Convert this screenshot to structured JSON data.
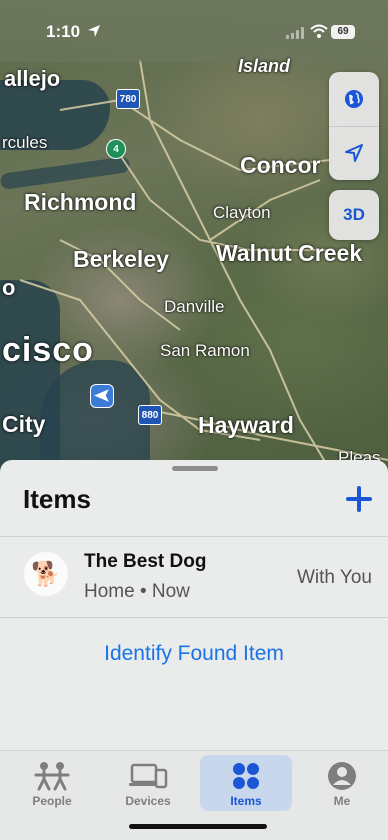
{
  "status_bar": {
    "time": "1:10",
    "battery": "69"
  },
  "map": {
    "places": [
      {
        "id": "vallejo",
        "label": "allejo"
      },
      {
        "id": "island",
        "label": "Island"
      },
      {
        "id": "hercules",
        "label": "rcules"
      },
      {
        "id": "concord",
        "label": "Concor"
      },
      {
        "id": "richmond",
        "label": "Richmond"
      },
      {
        "id": "clayton",
        "label": "Clayton"
      },
      {
        "id": "berkeley",
        "label": "Berkeley"
      },
      {
        "id": "walnut-creek",
        "label": "Walnut Creek"
      },
      {
        "id": "sf-o",
        "label": "o"
      },
      {
        "id": "danville",
        "label": "Danville"
      },
      {
        "id": "san-francisco",
        "label": "cisco"
      },
      {
        "id": "san-ramon",
        "label": "San Ramon"
      },
      {
        "id": "city",
        "label": "City"
      },
      {
        "id": "hayward",
        "label": "Hayward"
      },
      {
        "id": "pleasanton",
        "label": "Pleas"
      }
    ],
    "shields": {
      "i780": "780",
      "ca4": "4",
      "i880": "880"
    },
    "controls": {
      "globe_icon": "globe-icon",
      "location_icon": "location-arrow-icon",
      "three_d_label": "3D"
    }
  },
  "sheet": {
    "title": "Items",
    "add_icon": "plus-icon",
    "items": [
      {
        "emoji": "🐕",
        "name": "The Best Dog",
        "subtitle": "Home • Now",
        "status": "With You"
      }
    ],
    "identify_link": "Identify Found Item"
  },
  "tab_bar": {
    "tabs": [
      {
        "label": "People",
        "icon": "people-icon"
      },
      {
        "label": "Devices",
        "icon": "devices-icon"
      },
      {
        "label": "Items",
        "icon": "items-icon",
        "active": true
      },
      {
        "label": "Me",
        "icon": "person-circle-icon"
      }
    ]
  },
  "colors": {
    "accent": "#1a56d6",
    "link": "#1a73e8",
    "active_tab_bg": "#c8d7ec"
  }
}
